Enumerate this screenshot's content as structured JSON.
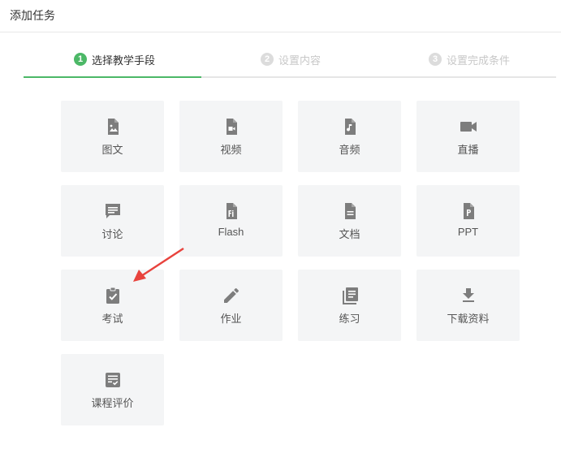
{
  "header": {
    "title": "添加任务"
  },
  "steps": [
    {
      "number": "1",
      "label": "选择教学手段",
      "state": "active"
    },
    {
      "number": "2",
      "label": "设置内容",
      "state": "inactive"
    },
    {
      "number": "3",
      "label": "设置完成条件",
      "state": "inactive"
    }
  ],
  "colors": {
    "accent": "#4cb867",
    "icon": "#7d7d7d",
    "tile_bg": "#f4f5f6",
    "arrow": "#e8433d"
  },
  "tiles": [
    {
      "label": "图文",
      "icon": "image-file-icon"
    },
    {
      "label": "视频",
      "icon": "video-file-icon"
    },
    {
      "label": "音频",
      "icon": "audio-file-icon"
    },
    {
      "label": "直播",
      "icon": "video-camera-icon"
    },
    {
      "label": "讨论",
      "icon": "chat-bubble-icon"
    },
    {
      "label": "Flash",
      "icon": "flash-file-icon"
    },
    {
      "label": "文档",
      "icon": "document-icon"
    },
    {
      "label": "PPT",
      "icon": "ppt-file-icon"
    },
    {
      "label": "考试",
      "icon": "clipboard-check-icon"
    },
    {
      "label": "作业",
      "icon": "pencil-icon"
    },
    {
      "label": "练习",
      "icon": "library-books-icon"
    },
    {
      "label": "下载资料",
      "icon": "download-icon"
    },
    {
      "label": "课程评价",
      "icon": "rating-form-icon"
    }
  ]
}
